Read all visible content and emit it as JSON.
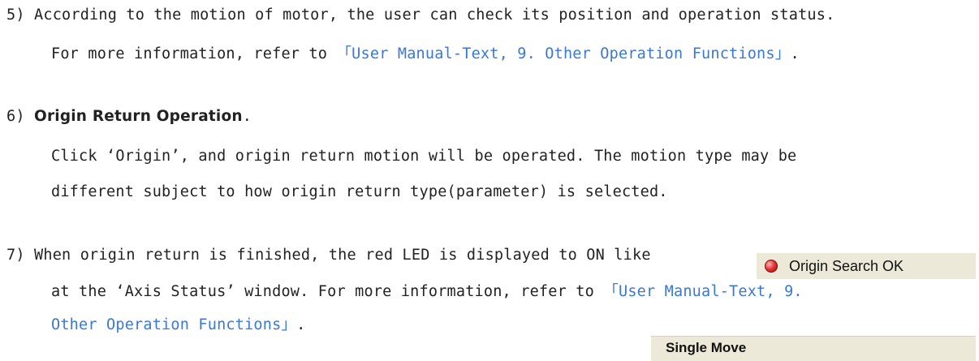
{
  "step5": {
    "line1": "5) According to the motion of motor, the user can check its position and operation status.",
    "line2_prefix": "For more information, refer to ",
    "line2_link": "「User Manual-Text, 9. Other Operation Functions」",
    "line2_suffix": "."
  },
  "step6": {
    "number": "6)",
    "heading": "Origin Return Operation",
    "heading_suffix": ".",
    "line2": "Click ‘Origin’, and origin return motion will be operated. The motion type may be",
    "line3": "different subject to how origin return type(parameter) is selected."
  },
  "step7": {
    "line1": "7) When origin return is finished, the red LED is displayed to ON like",
    "line2_prefix": "at the ‘Axis Status’ window. For more information, refer to ",
    "line2_link": "「User Manual-Text, 9.",
    "line3_link": "Other Operation Functions」",
    "line3_suffix": "."
  },
  "led_widget": {
    "icon": "red-led-icon",
    "label": "Origin Search OK",
    "led_color": "#e43030"
  },
  "panel": {
    "title": "Single Move"
  },
  "colors": {
    "link": "#3a78d8",
    "text": "#222222",
    "panel_bg": "#ece9d8"
  }
}
